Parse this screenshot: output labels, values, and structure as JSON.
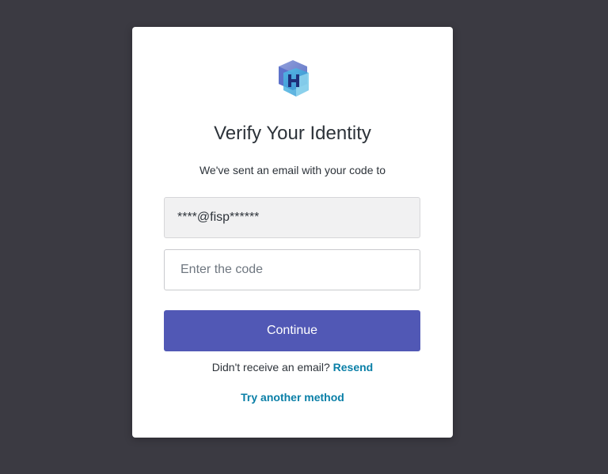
{
  "login": {
    "title": "Verify Your Identity",
    "subtitle": "We've sent an email with your code to",
    "email_value": "****@fisp******",
    "code_placeholder": "Enter the code",
    "continue_label": "Continue",
    "resend_prompt": "Didn't receive an email?",
    "resend_label": "Resend",
    "try_another_label": "Try another method",
    "logo_icon": "cube-logo-icon"
  },
  "colors": {
    "background": "#3b3a42",
    "card": "#ffffff",
    "primary_button": "#5158b5",
    "link": "#0a7fa7"
  }
}
